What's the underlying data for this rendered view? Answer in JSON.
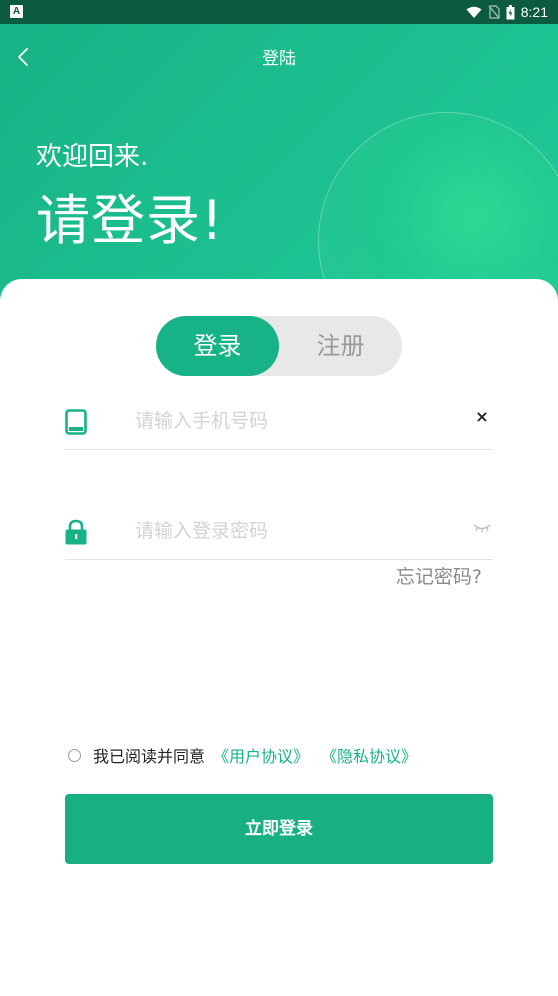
{
  "status_bar": {
    "app_letter": "A",
    "time": "8:21"
  },
  "header": {
    "title": "登陆",
    "welcome": "欢迎回来.",
    "headline": "请登录!"
  },
  "tabs": {
    "login": "登录",
    "register": "注册"
  },
  "phone_field": {
    "placeholder": "请输入手机号码",
    "clear_symbol": "×"
  },
  "password_field": {
    "placeholder": "请输入登录密码"
  },
  "forgot_password": "忘记密码?",
  "agreement": {
    "text": "我已阅读并同意",
    "user_agreement": "《用户协议》",
    "privacy_policy": "《隐私协议》"
  },
  "submit_label": "立即登录",
  "colors": {
    "brand_green": "#17b285",
    "status_bar": "#0c5a3f"
  },
  "icons": {
    "back": "chevron-left-icon",
    "phone": "tablet-icon",
    "lock": "lock-icon",
    "clear": "close-icon",
    "password_visibility": "eye-closed-icon"
  }
}
